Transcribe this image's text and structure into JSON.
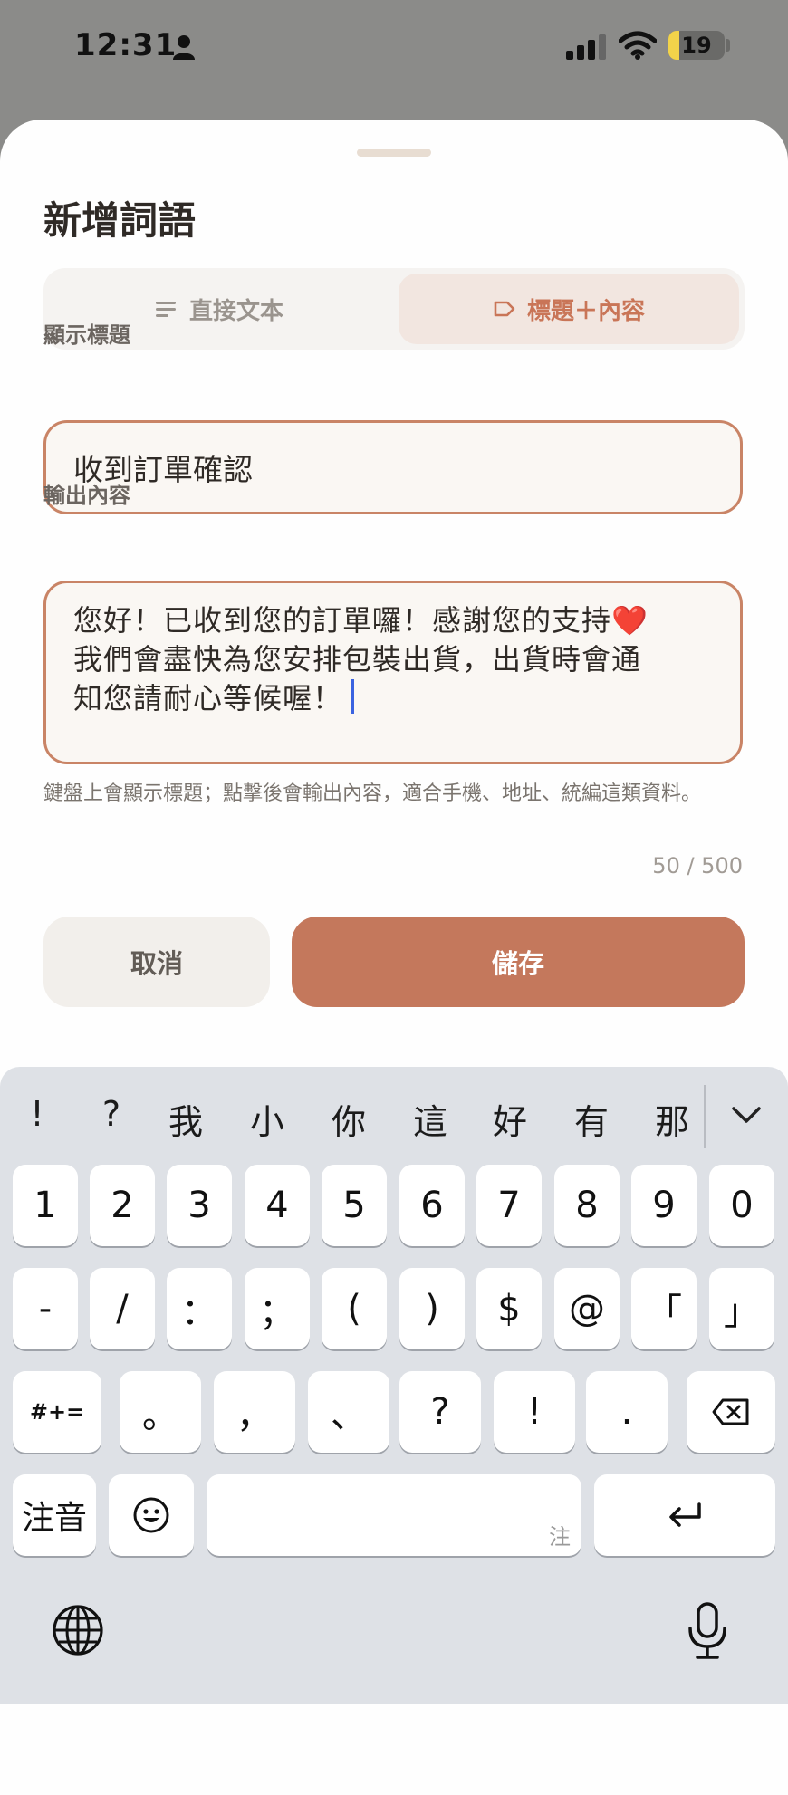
{
  "status_bar": {
    "time": "12:31",
    "battery_level": "19"
  },
  "sheet": {
    "title": "新增詞語",
    "mode_tabs": [
      {
        "label": "直接文本",
        "icon": "lines-icon",
        "selected": false
      },
      {
        "label": "標題＋內容",
        "icon": "tag-icon",
        "selected": true
      }
    ],
    "display_title": {
      "label": "顯示標題",
      "value": "收到訂單確認"
    },
    "output_content": {
      "label": "輸出內容",
      "lines": [
        "您好！已收到您的訂單囉！感謝您的支持❤️",
        "我們會盡快為您安排包裝出貨，出貨時會通",
        "知您請耐心等候喔！"
      ]
    },
    "hint": "鍵盤上會顯示標題；點擊後會輸出內容，適合手機、地址、統編這類資料。",
    "counter": "50 / 500",
    "cancel_label": "取消",
    "save_label": "儲存"
  },
  "keyboard": {
    "candidates": [
      "!",
      "?",
      "我",
      "小",
      "你",
      "這",
      "好",
      "有",
      "那"
    ],
    "row1": [
      "1",
      "2",
      "3",
      "4",
      "5",
      "6",
      "7",
      "8",
      "9",
      "0"
    ],
    "row2": [
      "-",
      "/",
      "：",
      "；",
      "(",
      ")",
      "$",
      "@",
      "「",
      "」"
    ],
    "row3": [
      "#+=",
      "。",
      "，",
      "、",
      "?",
      "!",
      "."
    ],
    "mode_key": "注音",
    "space_hint": "注",
    "accent": "#c4785c"
  }
}
